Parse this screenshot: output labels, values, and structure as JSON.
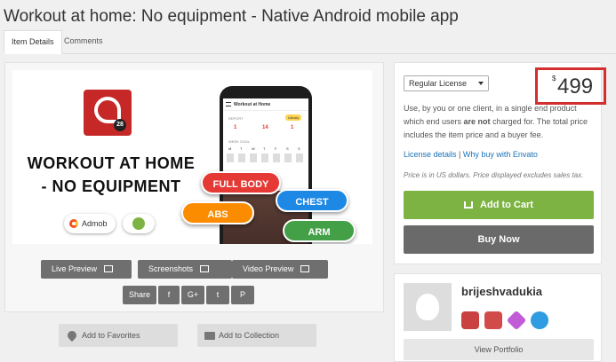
{
  "page": {
    "title": "Workout at home: No equipment - Native Android mobile app"
  },
  "tabs": [
    {
      "label": "Item Details"
    },
    {
      "label": "Comments"
    }
  ],
  "preview": {
    "headline": "WORKOUT AT HOME - NO EQUIPMENT",
    "app_icon_number": "28",
    "chips": [
      {
        "label": "Admob"
      },
      {
        "label": ""
      }
    ],
    "phone": {
      "app_title": "Workout at Home",
      "report_label": "REPORT",
      "library_label": "Library",
      "stats": [
        "1",
        "14",
        "1"
      ],
      "week_goal_label": "WEEK GOAL",
      "week_days": [
        "M",
        "T",
        "W",
        "T",
        "F",
        "S",
        "S"
      ]
    },
    "categories": [
      {
        "label": "FULL BODY",
        "color": "#e53935"
      },
      {
        "label": "CHEST",
        "color": "#1e88e5"
      },
      {
        "label": "ABS",
        "color": "#fb8c00"
      },
      {
        "label": "ARM",
        "color": "#43a047"
      }
    ]
  },
  "preview_buttons": {
    "live": "Live Preview",
    "screenshots": "Screenshots",
    "video": "Video Preview"
  },
  "share": {
    "label": "Share",
    "icons": [
      "f",
      "G+",
      "t",
      "P"
    ]
  },
  "actions": {
    "favorites": "Add to Favorites",
    "collection": "Add to Collection"
  },
  "license": {
    "selected": "Regular License",
    "currency": "$",
    "price": "499",
    "desc_before": "Use, by you or one client, in a single end product which end users ",
    "desc_bold": "are not",
    "desc_after": " charged for. The total price includes the item price and a buyer fee.",
    "details_link": "License details",
    "separator": " | ",
    "why_link": "Why buy with Envato",
    "note": "Price is in US dollars. Price displayed excludes sales tax.",
    "add_to_cart": "Add to Cart",
    "buy_now": "Buy Now"
  },
  "author": {
    "name": "brijeshvadukia",
    "badges": [
      {
        "icon": "badge-red-1-icon",
        "color": "#c94141"
      },
      {
        "icon": "badge-red-2-icon",
        "color": "#d24b4b"
      },
      {
        "icon": "badge-heart-icon",
        "color": "#c15bd6"
      },
      {
        "icon": "badge-bolt-icon",
        "color": "#2f9be0"
      }
    ],
    "portfolio": "View Portfolio"
  }
}
